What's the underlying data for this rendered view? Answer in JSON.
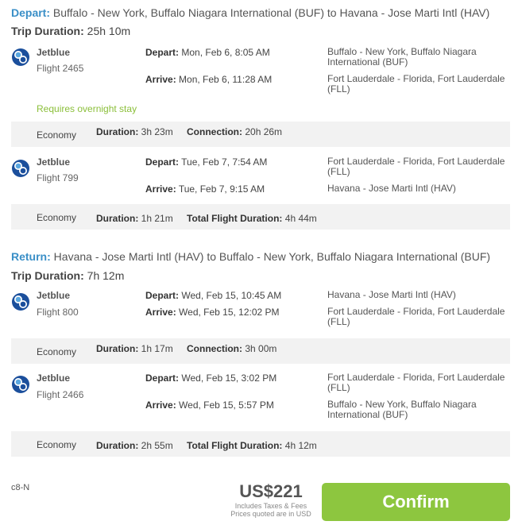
{
  "depart_section": {
    "keyword": "Depart:",
    "route": "Buffalo - New York, Buffalo Niagara International (BUF) to Havana - Jose Marti Intl (HAV)",
    "trip_duration_label": "Trip Duration:",
    "trip_duration": "25h 10m",
    "flights": [
      {
        "airline": "Jetblue",
        "flight": "Flight 2465",
        "depart_label": "Depart:",
        "depart_time": "Mon, Feb 6, 8:05 AM",
        "depart_place": "Buffalo - New York, Buffalo Niagara International (BUF)",
        "arrive_label": "Arrive:",
        "arrive_time": "Mon, Feb 6, 11:28 AM",
        "arrive_place": "Fort Lauderdale - Florida, Fort Lauderdale (FLL)",
        "note": "Requires overnight stay",
        "cabin": "Economy",
        "duration_label": "Duration:",
        "duration": "3h 23m",
        "extra_label": "Connection:",
        "extra": "20h 26m"
      },
      {
        "airline": "Jetblue",
        "flight": "Flight 799",
        "depart_label": "Depart:",
        "depart_time": "Tue, Feb 7, 7:54 AM",
        "depart_place": "Fort Lauderdale - Florida, Fort Lauderdale (FLL)",
        "arrive_label": "Arrive:",
        "arrive_time": "Tue, Feb 7, 9:15 AM",
        "arrive_place": "Havana - Jose Marti Intl (HAV)",
        "cabin": "Economy",
        "duration_label": "Duration:",
        "duration": "1h 21m",
        "extra_label": "Total Flight Duration:",
        "extra": "4h 44m"
      }
    ]
  },
  "return_section": {
    "keyword": "Return:",
    "route": "Havana - Jose Marti Intl (HAV) to Buffalo - New York, Buffalo Niagara International (BUF)",
    "trip_duration_label": "Trip Duration:",
    "trip_duration": "7h 12m",
    "flights": [
      {
        "airline": "Jetblue",
        "flight": "Flight 800",
        "depart_label": "Depart:",
        "depart_time": "Wed, Feb 15, 10:45 AM",
        "depart_place": "Havana - Jose Marti Intl (HAV)",
        "arrive_label": "Arrive:",
        "arrive_time": "Wed, Feb 15, 12:02 PM",
        "arrive_place": "Fort Lauderdale - Florida, Fort Lauderdale (FLL)",
        "cabin": "Economy",
        "duration_label": "Duration:",
        "duration": "1h 17m",
        "extra_label": "Connection:",
        "extra": "3h 00m"
      },
      {
        "airline": "Jetblue",
        "flight": "Flight 2466",
        "depart_label": "Depart:",
        "depart_time": "Wed, Feb 15, 3:02 PM",
        "depart_place": "Fort Lauderdale - Florida, Fort Lauderdale (FLL)",
        "arrive_label": "Arrive:",
        "arrive_time": "Wed, Feb 15, 5:57 PM",
        "arrive_place": "Buffalo - New York, Buffalo Niagara International (BUF)",
        "cabin": "Economy",
        "duration_label": "Duration:",
        "duration": "2h 55m",
        "extra_label": "Total Flight Duration:",
        "extra": "4h 12m"
      }
    ]
  },
  "footer": {
    "code": "c8-N",
    "price": "US$221",
    "taxes_note": "Includes Taxes & Fees",
    "currency_note": "Prices quoted are in USD",
    "confirm_label": "Confirm"
  },
  "colors": {
    "accent_blue": "#3a8fc7",
    "confirm_green": "#8dc63f",
    "note_green": "#8bbf3a",
    "bar_gray": "#f2f2f2"
  },
  "icons": {
    "airline_logo": "jetblue-logo-icon"
  }
}
